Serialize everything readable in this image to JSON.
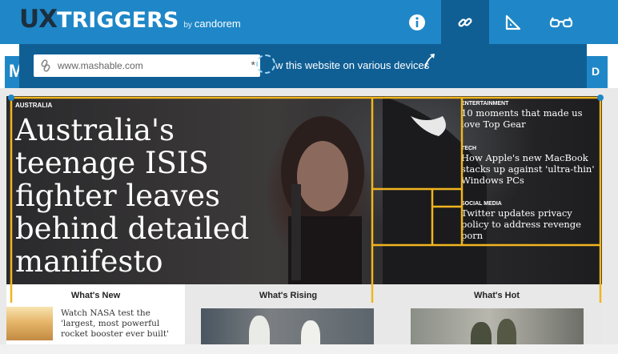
{
  "app": {
    "logo_ux": "UX",
    "logo_rest": "TRIGGERS",
    "logo_by": "by",
    "logo_brand": "candorem",
    "toolbar": [
      {
        "name": "info-icon"
      },
      {
        "name": "link-icon"
      },
      {
        "name": "set-square-icon"
      },
      {
        "name": "glasses-icon"
      }
    ]
  },
  "url_panel": {
    "url_value": "www.mashable.com",
    "star": "*",
    "preview_text": "w this website on various devices"
  },
  "hero": {
    "category": "AUSTRALIA",
    "title": "Australia's teenage ISIS fighter leaves behind detailed manifesto"
  },
  "side_stories": [
    {
      "category": "ENTERTAINMENT",
      "title": "10 moments that made us love Top Gear"
    },
    {
      "category": "TECH",
      "title": "How Apple's new MacBook stacks up against 'ultra-thin' Windows PCs"
    },
    {
      "category": "SOCIAL MEDIA",
      "title": "Twitter updates privacy policy to address revenge porn"
    }
  ],
  "columns": {
    "new": {
      "heading": "What's New",
      "story": "Watch NASA test the 'largest, most powerful rocket booster ever built'"
    },
    "rising": {
      "heading": "What's Rising"
    },
    "hot": {
      "heading": "What's Hot"
    }
  },
  "colors": {
    "toolbar": "#1f87c7",
    "toolbar_active": "#0f5f95",
    "grid_lines": "#f2b51f"
  }
}
